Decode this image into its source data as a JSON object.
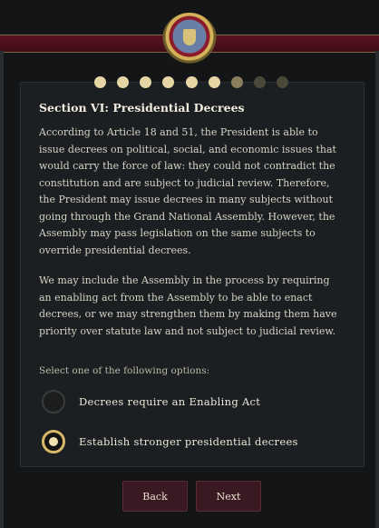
{
  "section_title": "Section VI: Presidential Decrees",
  "paragraphs": [
    "According to Article 18 and 51, the President is able to issue decrees on political, social, and economic issues that would carry the force of law: they could not contradict the constitution and are subject to judicial review. Therefore, the President may issue decrees in many subjects without going through the Grand National Assembly. However, the Assembly may pass legislation on the same subjects to override presidential decrees.",
    "We may include the Assembly in the process by requiring an enabling act from the Assembly to be able to enact decrees, or we may strengthen them by making them have priority over statute law and not subject to judicial review."
  ],
  "prompt": "Select one of the following options:",
  "options": [
    {
      "label": "Decrees require an Enabling Act",
      "selected": false
    },
    {
      "label": "Establish stronger presidential decrees",
      "selected": true
    }
  ],
  "progress": {
    "total_steps": 9,
    "completed_steps": 6,
    "current_step": 7
  },
  "buttons": {
    "back": "Back",
    "next": "Next"
  },
  "colors": {
    "accent_gold": "#d8b96a",
    "button_bg": "#3a1a22",
    "banner_red": "#5a1320"
  }
}
